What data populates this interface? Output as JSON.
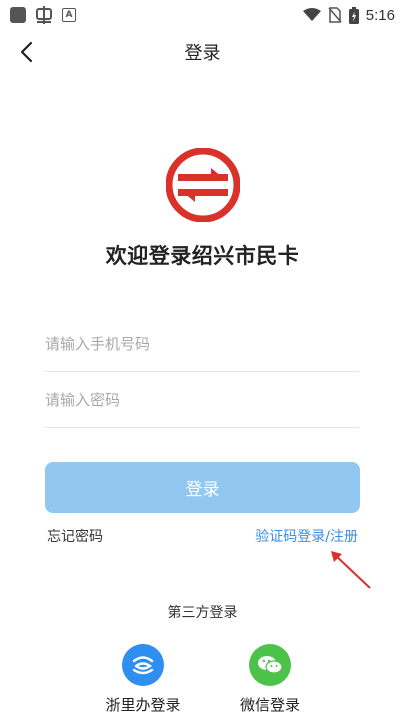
{
  "status_bar": {
    "time": "5:16",
    "icons": [
      "square-icon",
      "bug-icon",
      "a-icon",
      "wifi-icon",
      "no-sim-icon",
      "battery-icon"
    ],
    "a_icon_text": "A"
  },
  "nav": {
    "title": "登录",
    "back_icon": "chevron-left-icon"
  },
  "logo": {
    "name": "shaoxing-citizen-card-logo",
    "color": "#d9322b"
  },
  "welcome": "欢迎登录绍兴市民卡",
  "form": {
    "phone_placeholder": "请输入手机号码",
    "phone_value": "",
    "password_placeholder": "请输入密码",
    "password_value": ""
  },
  "login_button": "登录",
  "links": {
    "forgot": "忘记密码",
    "code_login": "验证码登录/注册"
  },
  "third_party": {
    "title": "第三方登录",
    "options": [
      {
        "label": "浙里办登录",
        "icon": "zheliban-icon",
        "color": "#2f8ff0"
      },
      {
        "label": "微信登录",
        "icon": "wechat-icon",
        "color": "#4cc24a"
      }
    ]
  },
  "colors": {
    "primary_button": "#92c7f1",
    "link": "#3a8ee0",
    "annotation_arrow": "#d9322b"
  }
}
